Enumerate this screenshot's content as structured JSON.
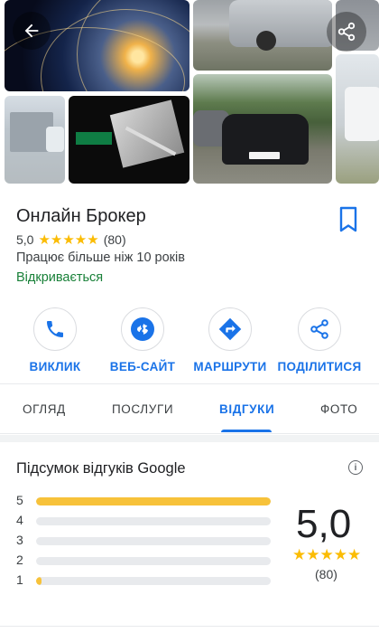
{
  "business": {
    "name": "Онлайн Брокер",
    "rating": "5,0",
    "stars": "★★★★★",
    "review_count": "(80)",
    "years": "Працює більше ніж 10 років",
    "status": "Відкривається"
  },
  "actions": [
    {
      "label": "ВИКЛИК",
      "icon": "phone-icon"
    },
    {
      "label": "ВЕБ-САЙТ",
      "icon": "globe-icon"
    },
    {
      "label": "МАРШРУТИ",
      "icon": "directions-icon"
    },
    {
      "label": "ПОДІЛИТИСЯ",
      "icon": "share-icon"
    }
  ],
  "tabs": [
    {
      "label": "ОГЛЯД",
      "active": false
    },
    {
      "label": "ПОСЛУГИ",
      "active": false
    },
    {
      "label": "ВІДГУКИ",
      "active": true
    },
    {
      "label": "ФОТО",
      "active": false
    }
  ],
  "summary": {
    "title": "Підсумок відгуків Google",
    "score": "5,0",
    "stars": "★★★★★",
    "count": "(80)",
    "distribution": [
      {
        "star": "5",
        "fraction": 1.0
      },
      {
        "star": "4",
        "fraction": 0.0
      },
      {
        "star": "3",
        "fraction": 0.0
      },
      {
        "star": "2",
        "fraction": 0.0
      },
      {
        "star": "1",
        "fraction": 0.01
      }
    ]
  },
  "colors": {
    "accent": "#1a73e8",
    "star": "#fbbc04",
    "bar": "#f7c23a",
    "open": "#188038"
  }
}
